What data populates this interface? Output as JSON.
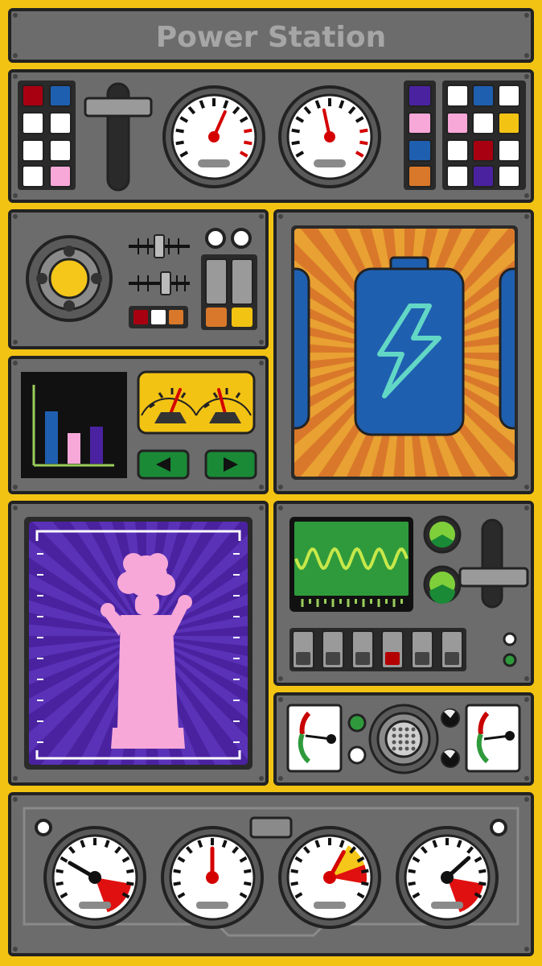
{
  "title": "Power Station",
  "colors": {
    "frame": "#f3c313",
    "panel": "#6c6c6c",
    "dark_outline": "#222222",
    "screen_orange": "#e8a132",
    "battery_blue": "#1f5fb0",
    "bolt_teal": "#62d7c6",
    "screen_purple": "#4a22a0",
    "silhouette_pink": "#f7a8d8",
    "wave_green": "#2f9a3c",
    "red": "#b30000"
  },
  "gauges": {
    "top_left": {
      "level": 0.6
    },
    "top_right": {
      "level": 0.45
    },
    "bottom": [
      {
        "level": 0.25
      },
      {
        "level": 0.5
      },
      {
        "level": 0.62
      },
      {
        "level": 0.7
      }
    ]
  },
  "bar_chart": {
    "values": [
      0.65,
      0.38,
      0.46
    ],
    "colors": [
      "#1f5fb0",
      "#f7a8d8",
      "#4a22a0"
    ]
  },
  "icons": {
    "battery": "battery-lightning-icon",
    "character": "character-silhouette-icon",
    "left_arrow": "arrow-left-icon",
    "right_arrow": "arrow-right-icon"
  }
}
